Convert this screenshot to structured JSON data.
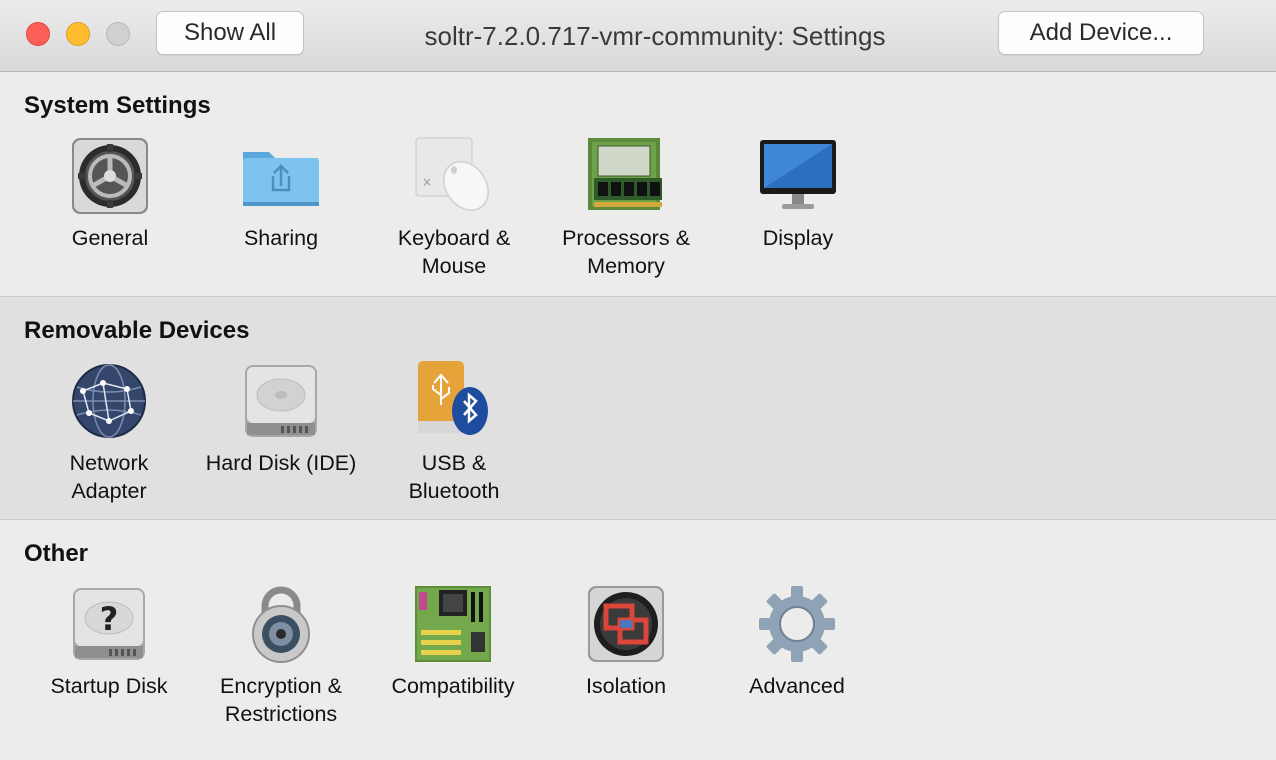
{
  "window": {
    "title": "soltr-7.2.0.717-vmr-community: Settings",
    "show_all_label": "Show All",
    "add_device_label": "Add Device..."
  },
  "sections": {
    "system": {
      "title": "System Settings",
      "items": [
        {
          "label_line1": "General",
          "label_line2": "",
          "icon": "general-icon"
        },
        {
          "label_line1": "Sharing",
          "label_line2": "",
          "icon": "sharing-folder-icon"
        },
        {
          "label_line1": "Keyboard &",
          "label_line2": "Mouse",
          "icon": "keyboard-mouse-icon"
        },
        {
          "label_line1": "Processors &",
          "label_line2": "Memory",
          "icon": "memory-chip-icon"
        },
        {
          "label_line1": "Display",
          "label_line2": "",
          "icon": "display-monitor-icon"
        }
      ]
    },
    "removable": {
      "title": "Removable Devices",
      "items": [
        {
          "label_line1": "Network",
          "label_line2": "Adapter",
          "icon": "network-globe-icon"
        },
        {
          "label_line1": "Hard Disk (IDE)",
          "label_line2": "",
          "icon": "hard-disk-icon"
        },
        {
          "label_line1": "USB &",
          "label_line2": "Bluetooth",
          "icon": "usb-bluetooth-icon"
        }
      ]
    },
    "other": {
      "title": "Other",
      "items": [
        {
          "label_line1": "Startup Disk",
          "label_line2": "",
          "icon": "startup-disk-icon"
        },
        {
          "label_line1": "Encryption &",
          "label_line2": "Restrictions",
          "icon": "padlock-icon"
        },
        {
          "label_line1": "Compatibility",
          "label_line2": "",
          "icon": "motherboard-icon"
        },
        {
          "label_line1": "Isolation",
          "label_line2": "",
          "icon": "isolation-icon"
        },
        {
          "label_line1": "Advanced",
          "label_line2": "",
          "icon": "gear-icon"
        }
      ]
    }
  },
  "colors": {
    "close": "#fc5f57",
    "minimize": "#fdbd2e",
    "zoom_disabled": "#d0d0d0"
  }
}
